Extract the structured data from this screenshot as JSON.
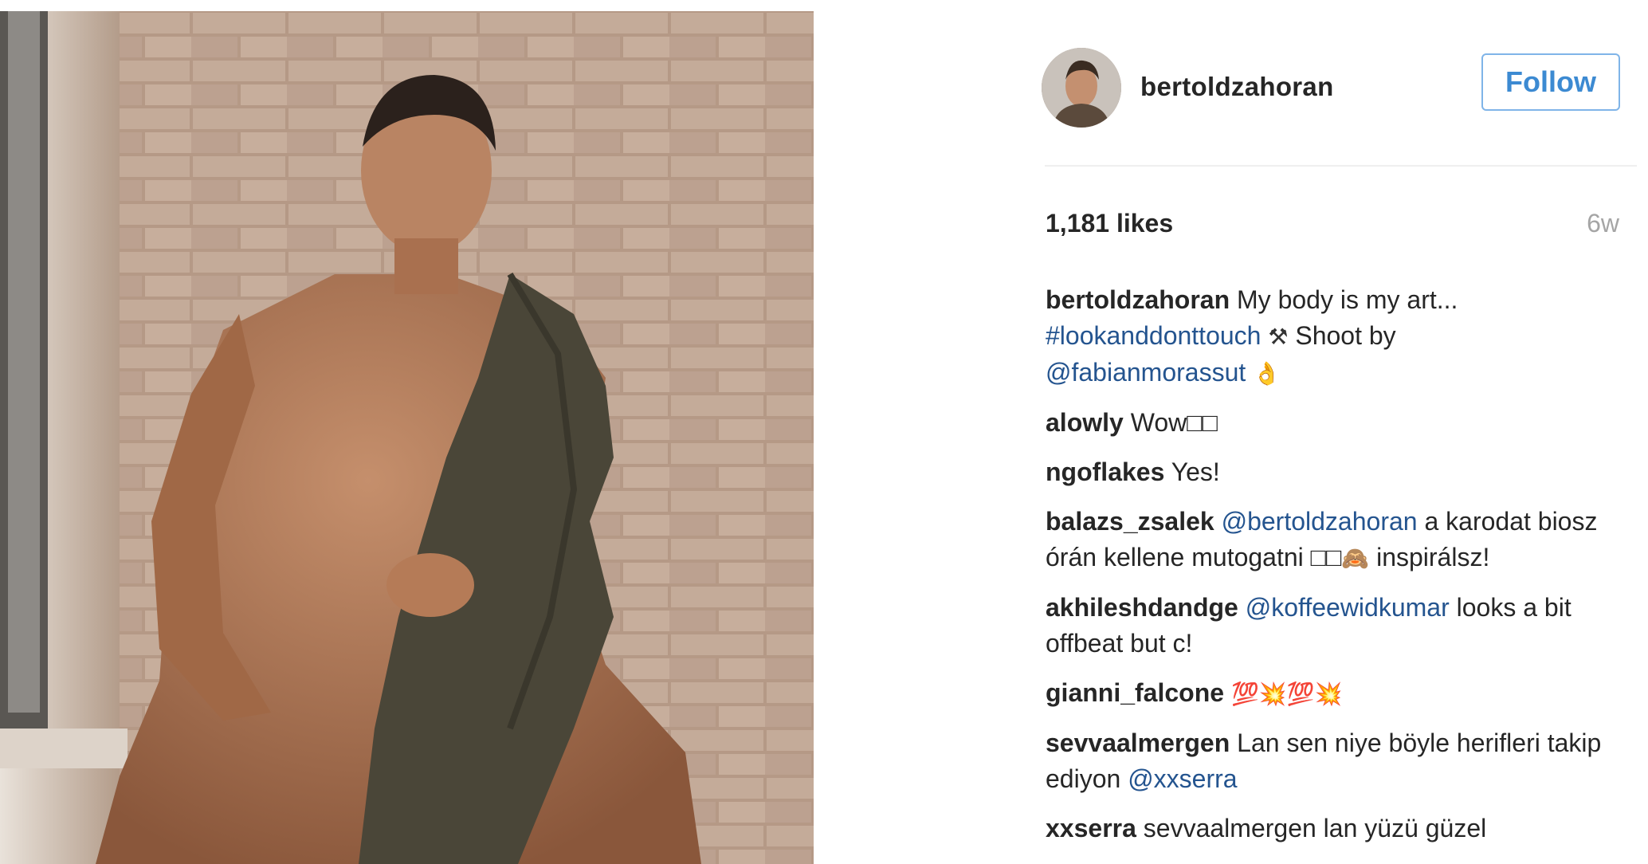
{
  "post": {
    "username": "bertoldzahoran",
    "follow_label": "Follow",
    "likes": "1,181 likes",
    "time": "6w"
  },
  "icons": {
    "avatar": "profile-photo",
    "hammer": "hammer-and-pick-icon",
    "ok_hand": "ok-hand-icon",
    "monkey": "see-no-evil-monkey-icon"
  },
  "caption": {
    "user": "bertoldzahoran",
    "text1": " My body is my art...",
    "hashtag": "#lookanddonttouch",
    "text2": " Shoot by",
    "mention": "@fabianmorassut",
    "emoji1": "⚒",
    "emoji2": "👌"
  },
  "comments": [
    {
      "user": "alowly",
      "text": " Wow□□"
    },
    {
      "user": "ngoflakes",
      "text": " Yes!"
    },
    {
      "user": "balazs_zsalek",
      "mention": "@bertoldzahoran",
      "text": " a karodat biosz órán kellene mutogatni □□",
      "emoji": "🙈",
      "text_after": " inspirálsz!"
    },
    {
      "user": "akhileshdandge",
      "mention": "@koffeewidkumar",
      "text": " looks a bit offbeat but c!"
    },
    {
      "user": "gianni_falcone",
      "text": " 💯💥💯💥"
    },
    {
      "user": "sevvaalmergen",
      "text": " Lan sen niye böyle herifleri takip ediyon ",
      "mention": "@xxserra"
    },
    {
      "user": "xxserra",
      "text": " sevvaalmergen lan yüzü güzel"
    }
  ],
  "colors": {
    "link": "#24548f",
    "follow": "#3c8ad2",
    "muted": "#a5a5a5",
    "text": "#262626"
  }
}
